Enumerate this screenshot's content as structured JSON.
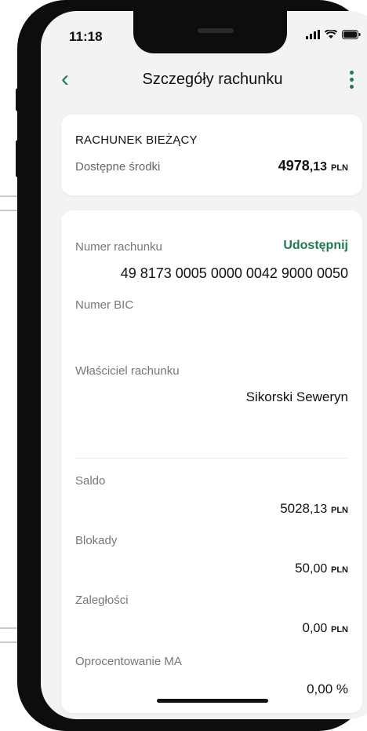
{
  "status_bar": {
    "time": "11:18"
  },
  "nav": {
    "title": "Szczegóły rachunku"
  },
  "account_summary": {
    "name": "RACHUNEK BIEŻĄCY",
    "available_label": "Dostępne środki",
    "available_int": "4978",
    "available_dec": ",13",
    "currency": "PLN"
  },
  "details": {
    "number_label": "Numer rachunku",
    "share_label": "Udostępnij",
    "number_value": "49 8173 0005 0000 0042 9000 0050",
    "bic_label": "Numer BIC",
    "owner_label": "Właściciel rachunku",
    "owner_value": "Sikorski Seweryn",
    "balance_label": "Saldo",
    "balance_int": "5028",
    "balance_dec": ",13",
    "blocks_label": "Blokady",
    "blocks_int": "50",
    "blocks_dec": ",00",
    "arrears_label": "Zaległości",
    "arrears_int": "0",
    "arrears_dec": ",00",
    "interest_label": "Oprocentowanie MA",
    "interest_value": "0,00 %",
    "currency": "PLN"
  },
  "colors": {
    "accent": "#1f7a4f",
    "background": "#f3f3f3",
    "card": "#ffffff"
  }
}
